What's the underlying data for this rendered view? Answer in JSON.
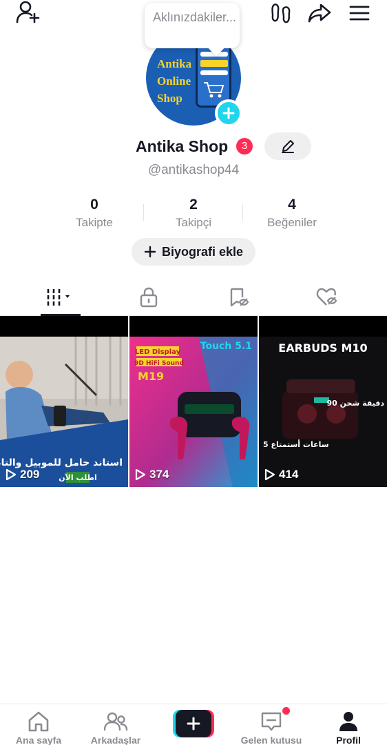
{
  "tooltip": {
    "text": "Aklınızdakiler..."
  },
  "profile": {
    "avatar_text": [
      "Antika",
      "Online",
      "Shop"
    ],
    "display_name": "Antika Shop",
    "badge_count": "3",
    "username": "@antikashop44"
  },
  "stats": [
    {
      "value": "0",
      "label": "Takipte"
    },
    {
      "value": "2",
      "label": "Takipçi"
    },
    {
      "value": "4",
      "label": "Beğeniler"
    }
  ],
  "bio_button": {
    "label": "Biyografi ekle"
  },
  "tabs": [
    {
      "icon": "grid-icon",
      "active": true
    },
    {
      "icon": "lock-icon",
      "active": false
    },
    {
      "icon": "saved-icon",
      "active": false
    },
    {
      "icon": "liked-icon",
      "active": false
    }
  ],
  "videos": [
    {
      "views": "209",
      "overlay_lines": [
        "استاند حامل للموبيل والتابلت",
        "اطلب الآن"
      ]
    },
    {
      "views": "374",
      "overlay_lines": [
        "LED Display",
        "9D HiFi Sound",
        "M19",
        "Touch 5.1"
      ]
    },
    {
      "views": "414",
      "overlay_lines": [
        "EARBUDS M10",
        "90 دقيقة شحن",
        "5 ساعات أستمتاع"
      ]
    }
  ],
  "bottom_nav": [
    {
      "label": "Ana sayfa",
      "icon": "home-icon",
      "active": false
    },
    {
      "label": "Arkadaşlar",
      "icon": "friends-icon",
      "active": false
    },
    {
      "label": "",
      "icon": "plus-icon",
      "active": false
    },
    {
      "label": "Gelen kutusu",
      "icon": "inbox-icon",
      "active": false
    },
    {
      "label": "Profil",
      "icon": "profile-icon",
      "active": true
    }
  ],
  "colors": {
    "accent": "#fe2c55",
    "cyan": "#20d5ec",
    "text": "#161823",
    "muted": "#8a8b91"
  }
}
